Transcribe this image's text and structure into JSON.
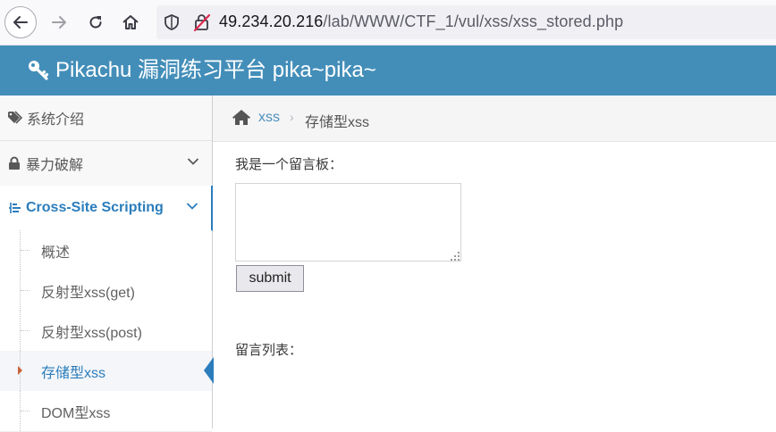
{
  "browser": {
    "url_host": "49.234.20.216",
    "url_path": "/lab/WWW/CTF_1/vul/xss/xss_stored.php"
  },
  "header": {
    "title": "Pikachu 漏洞练习平台 pika~pika~"
  },
  "sidebar": {
    "items": [
      {
        "label": "系统介绍"
      },
      {
        "label": "暴力破解"
      },
      {
        "label": "Cross-Site Scripting"
      }
    ],
    "sub_items": [
      {
        "label": "概述"
      },
      {
        "label": "反射型xss(get)"
      },
      {
        "label": "反射型xss(post)"
      },
      {
        "label": "存储型xss"
      },
      {
        "label": "DOM型xss"
      }
    ]
  },
  "breadcrumb": {
    "link": "xss",
    "separator": "›",
    "current": "存储型xss"
  },
  "main": {
    "board_label": "我是一个留言板：",
    "textarea_value": "",
    "submit_label": "submit",
    "list_label": "留言列表："
  },
  "colors": {
    "header_bg": "#438eb9",
    "accent": "#2b7dbc",
    "caret": "#c86139"
  }
}
